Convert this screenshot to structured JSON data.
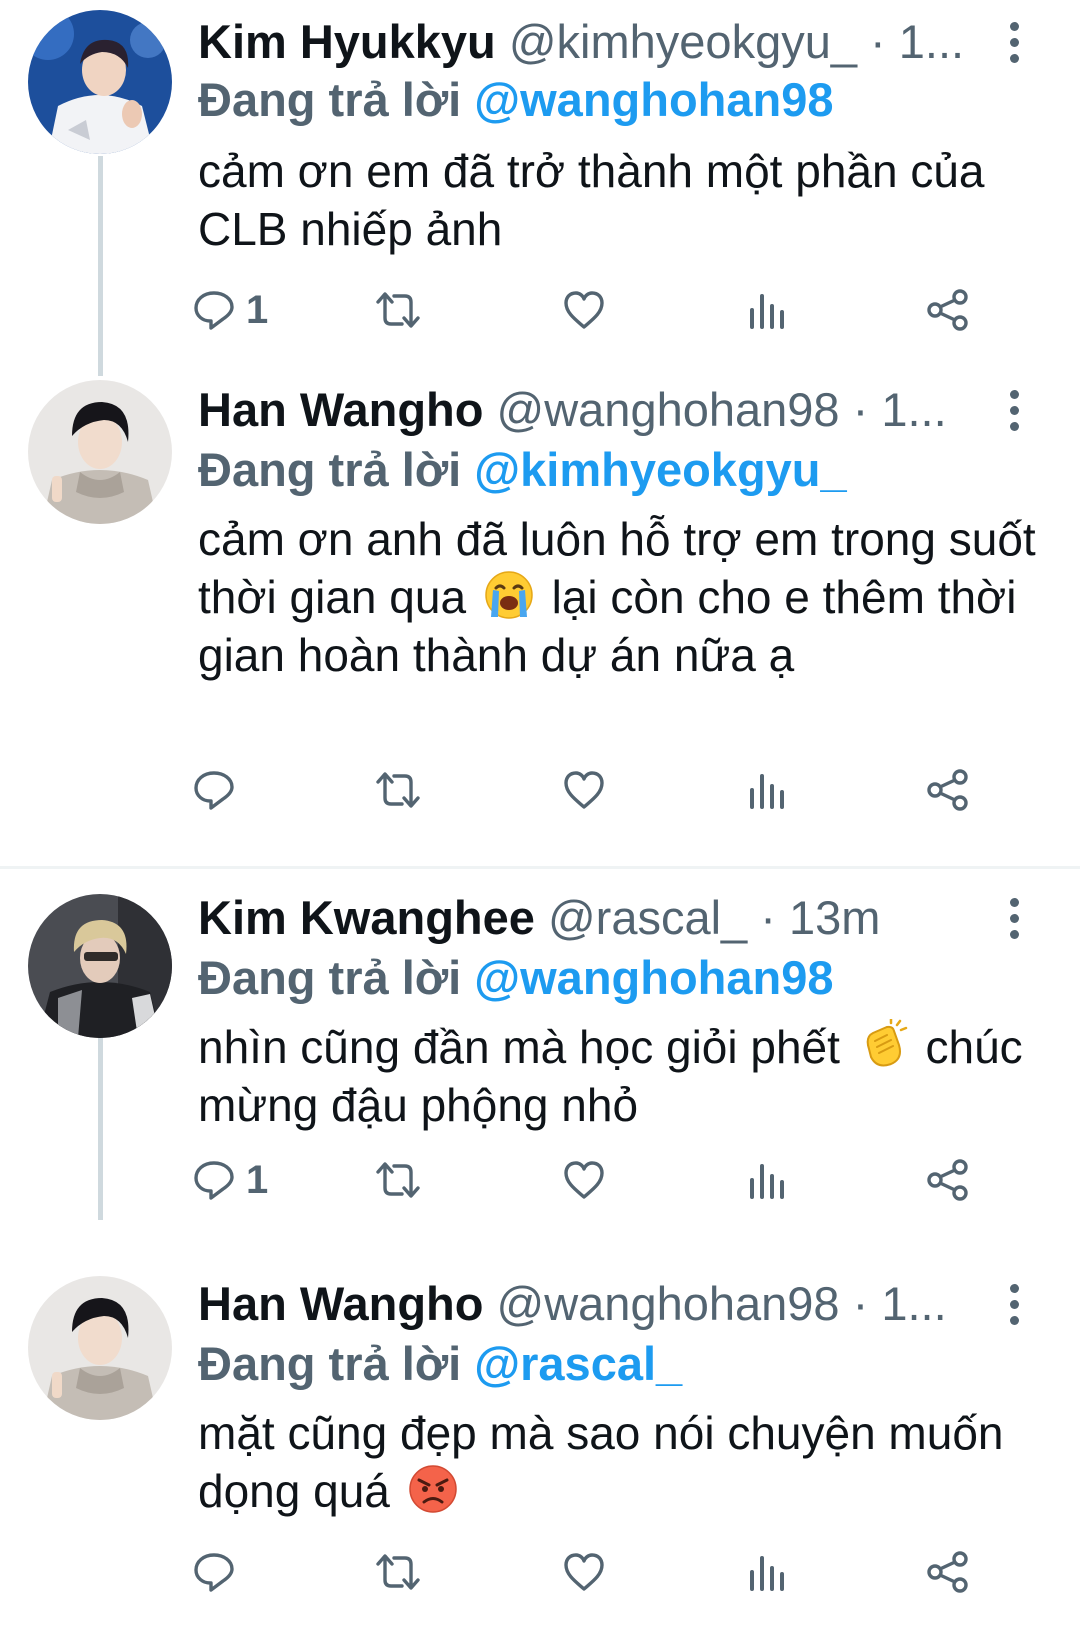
{
  "reply_prefix": "Đang trả lời",
  "tweets": [
    {
      "name": "Kim Hyukkyu",
      "handle": "@kimhyeokgyu_",
      "time": "· 1...",
      "reply_to": "@wanghohan98",
      "text": "cảm ơn em đã trở thành một phần của CLB nhiếp ảnh",
      "reply_count": "1"
    },
    {
      "name": "Han Wangho",
      "handle": "@wanghohan98",
      "time": "· 1...",
      "reply_to": "@kimhyeokgyu_",
      "text_before_emoji": "cảm ơn anh đã luôn hỗ trợ em trong suốt thời gian qua",
      "emoji": "loudly-crying-face",
      "text_after_emoji": "lại còn cho e thêm thời gian hoàn thành dự án nữa ạ",
      "reply_count": ""
    },
    {
      "name": "Kim Kwanghee",
      "handle": "@rascal_",
      "time": "· 13m",
      "reply_to": "@wanghohan98",
      "text_before_emoji": "nhìn cũng đần mà học giỏi phết",
      "emoji": "clapping-hands",
      "text_after_emoji": "chúc mừng đậu phộng nhỏ",
      "reply_count": "1"
    },
    {
      "name": "Han Wangho",
      "handle": "@wanghohan98",
      "time": "· 1...",
      "reply_to": "@rascal_",
      "text_before_emoji": "mặt cũng đẹp mà sao nói chuyện muốn dọng quá",
      "emoji": "angry-face",
      "reply_count": ""
    }
  ],
  "colors": {
    "text": "#0f1419",
    "secondary": "#536471",
    "mention": "#1d9bf0",
    "thread_line": "#cfd9de",
    "divider": "#eff3f4"
  },
  "icons": [
    "reply-icon",
    "retweet-icon",
    "like-icon",
    "analytics-icon",
    "share-icon",
    "more-icon"
  ]
}
